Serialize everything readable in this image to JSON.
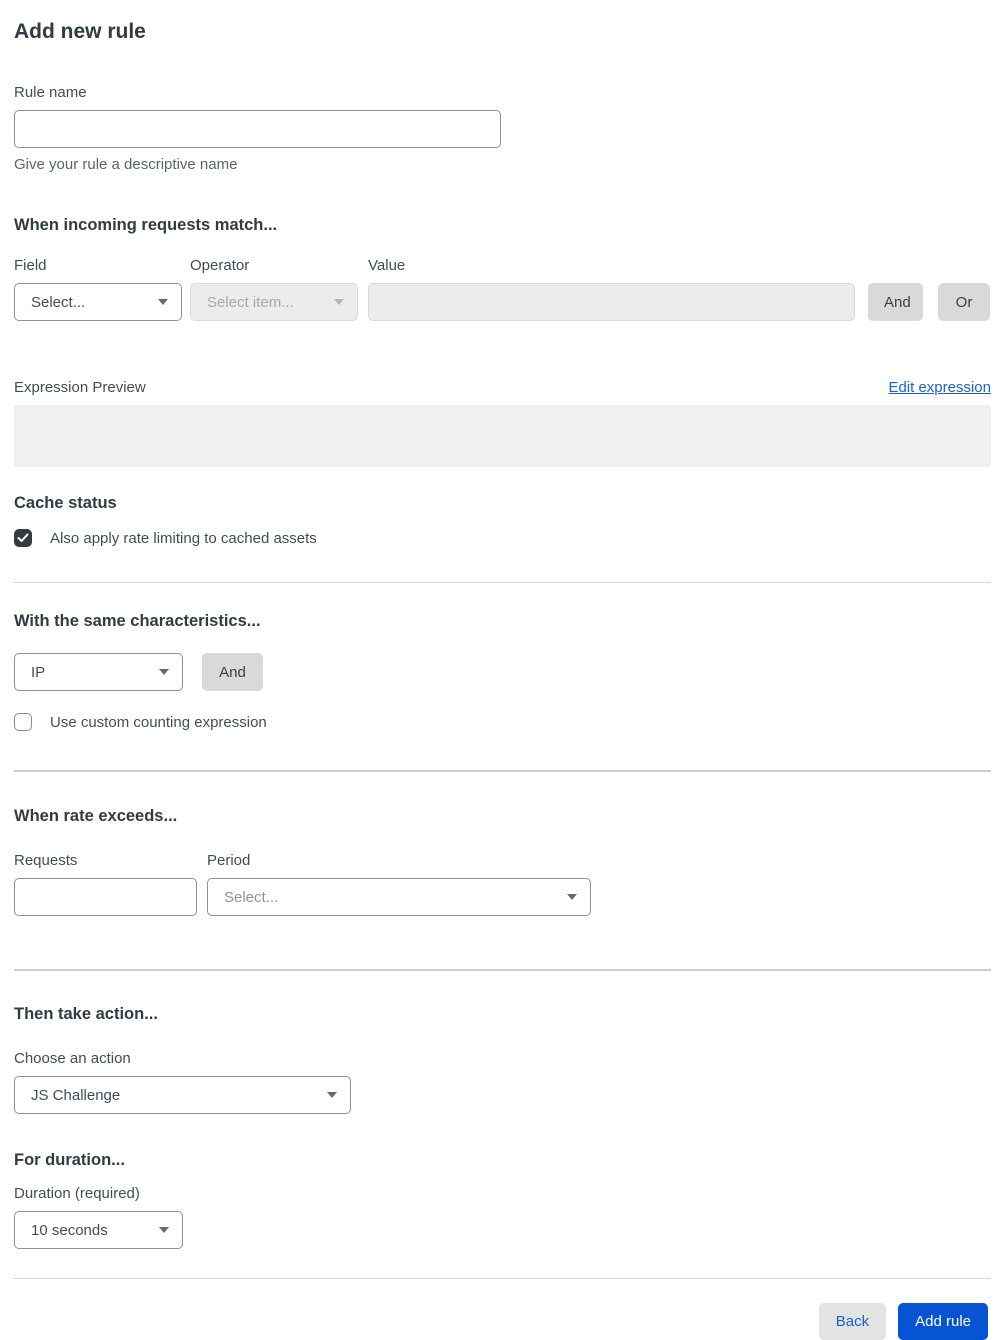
{
  "page": {
    "title": "Add new rule"
  },
  "rule_name": {
    "label": "Rule name",
    "value": "",
    "helper": "Give your rule a descriptive name"
  },
  "match_section": {
    "heading": "When incoming requests match...",
    "field": {
      "label": "Field",
      "selected": "Select..."
    },
    "operator": {
      "label": "Operator",
      "selected": "Select item...",
      "disabled": true
    },
    "value": {
      "label": "Value",
      "value": "",
      "disabled": true
    },
    "and_button": "And",
    "or_button": "Or",
    "expression_preview_label": "Expression Preview",
    "edit_expression_link": "Edit expression",
    "expression_preview_value": ""
  },
  "cache_status_section": {
    "heading": "Cache status",
    "checkbox_label": "Also apply rate limiting to cached assets",
    "checked": true
  },
  "characteristics_section": {
    "heading": "With the same characteristics...",
    "characteristic_selected": "IP",
    "and_button": "And",
    "custom_counting_label": "Use custom counting expression",
    "custom_counting_checked": false
  },
  "rate_section": {
    "heading": "When rate exceeds...",
    "requests": {
      "label": "Requests",
      "value": ""
    },
    "period": {
      "label": "Period",
      "selected": "Select..."
    }
  },
  "action_section": {
    "heading": "Then take action...",
    "choose_label": "Choose an action",
    "action_selected": "JS Challenge"
  },
  "duration_section": {
    "heading": "For duration...",
    "label": "Duration (required)",
    "selected": "10 seconds"
  },
  "footer": {
    "back_label": "Back",
    "add_rule_label": "Add rule"
  },
  "colors": {
    "primary_blue": "#0654d4",
    "link_blue": "#1b62c8",
    "checkbox_dark": "#36393f",
    "disabled_bg": "#ececec",
    "button_gray": "#d9d9d9"
  }
}
